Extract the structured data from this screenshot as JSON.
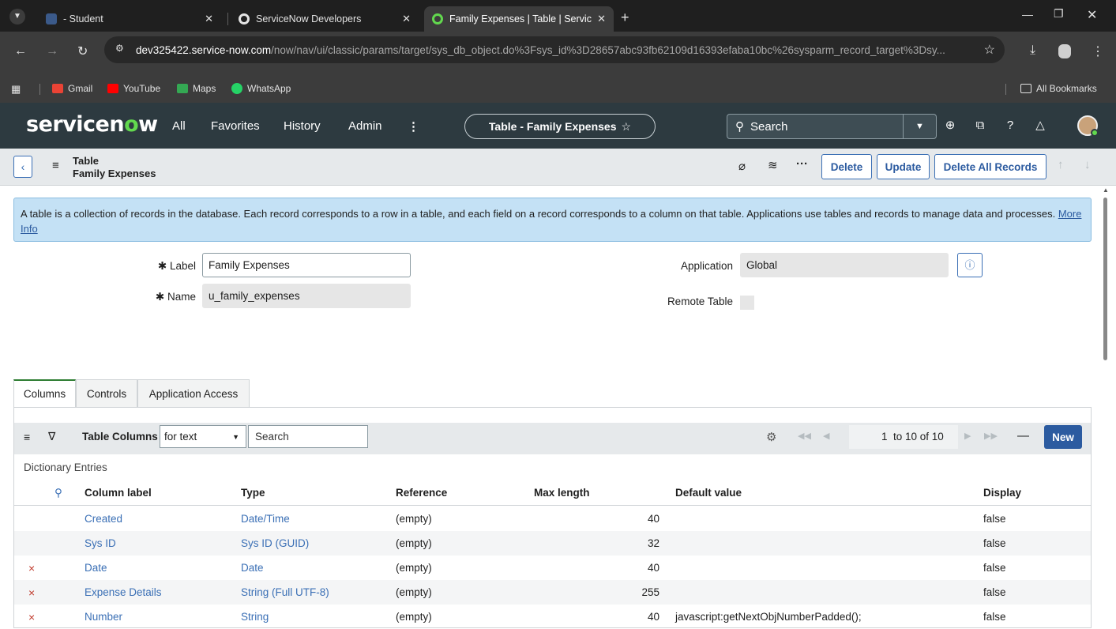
{
  "browser": {
    "tabs": [
      {
        "label": "- Student"
      },
      {
        "label": "ServiceNow Developers"
      },
      {
        "label": "Family Expenses | Table | Servic"
      }
    ],
    "url_host": "dev325422.service-now.com",
    "url_path": "/now/nav/ui/classic/params/target/sys_db_object.do%3Fsys_id%3D28657abc93fb62109d16393efaba10bc%26sysparm_record_target%3Dsy...",
    "bookmarks": [
      "Gmail",
      "YouTube",
      "Maps",
      "WhatsApp"
    ],
    "all_bookmarks": "All Bookmarks"
  },
  "sn": {
    "logo_a": "servicen",
    "logo_o": "o",
    "logo_b": "w",
    "nav": [
      "All",
      "Favorites",
      "History",
      "Admin"
    ],
    "context": "Table - Family Expenses",
    "search": "Search"
  },
  "form": {
    "title": "Table",
    "subtitle": "Family Expenses",
    "buttons": {
      "delete": "Delete",
      "update": "Update",
      "delete_all": "Delete All Records"
    },
    "banner_text": "A table is a collection of records in the database. Each record corresponds to a row in a table, and each field on a record corresponds to a column on that table. Applications use tables and records to manage data and processes.",
    "banner_link": "More Info",
    "label_label": "Label",
    "label_value": "Family Expenses",
    "name_label": "Name",
    "name_value": "u_family_expenses",
    "application_label": "Application",
    "application_value": "Global",
    "remote_label": "Remote Table"
  },
  "related": {
    "tabs": [
      "Columns",
      "Controls",
      "Application Access"
    ],
    "list_title": "Table Columns",
    "filter_select": "for text",
    "search_placeholder": "Search",
    "pagination": "1  to 10 of 10",
    "new": "New",
    "section": "Dictionary Entries",
    "headers": [
      "Column label",
      "Type",
      "Reference",
      "Max length",
      "Default value",
      "Display"
    ],
    "rows": [
      {
        "del": "",
        "label": "Created",
        "type": "Date/Time",
        "ref": "(empty)",
        "max": "40",
        "default": "",
        "display": "false"
      },
      {
        "del": "",
        "label": "Sys ID",
        "type": "Sys ID (GUID)",
        "ref": "(empty)",
        "max": "32",
        "default": "",
        "display": "false"
      },
      {
        "del": "×",
        "label": "Date",
        "type": "Date",
        "ref": "(empty)",
        "max": "40",
        "default": "",
        "display": "false"
      },
      {
        "del": "×",
        "label": "Expense Details",
        "type": "String (Full UTF-8)",
        "ref": "(empty)",
        "max": "255",
        "default": "",
        "display": "false"
      },
      {
        "del": "×",
        "label": "Number",
        "type": "String",
        "ref": "(empty)",
        "max": "40",
        "default": "javascript:getNextObjNumberPadded();",
        "display": "false"
      }
    ]
  }
}
